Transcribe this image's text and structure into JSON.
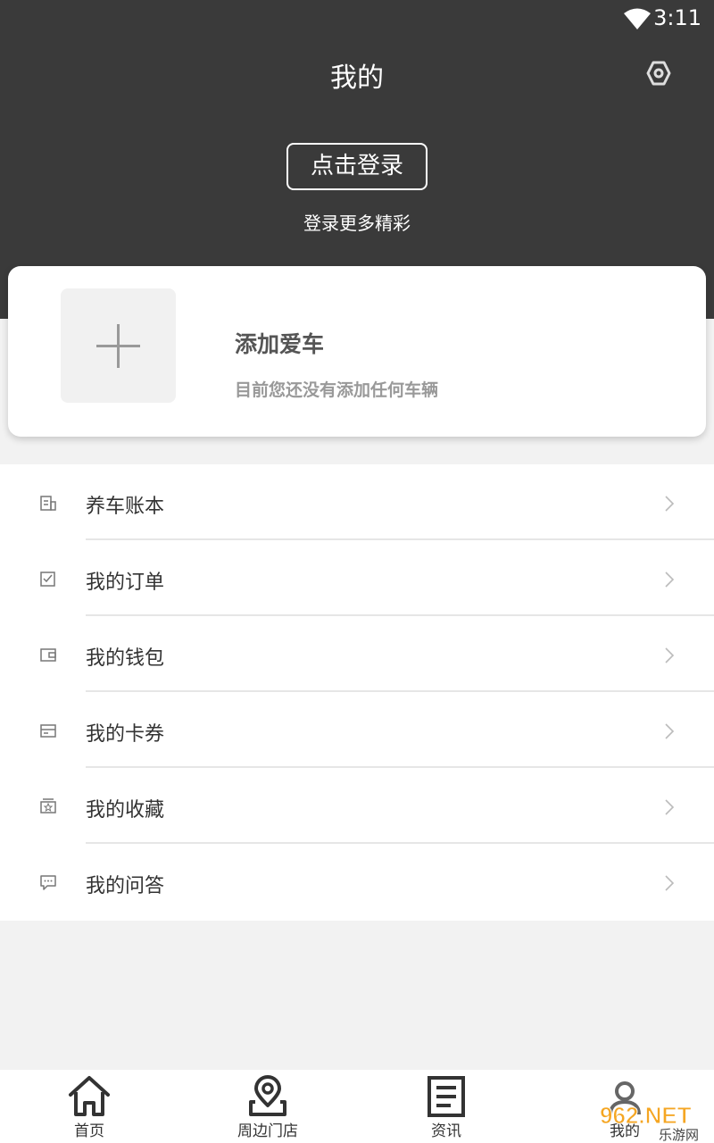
{
  "status_bar": {
    "time": "3:11"
  },
  "header": {
    "title": "我的",
    "login_button": "点击登录",
    "login_subtitle": "登录更多精彩"
  },
  "car_card": {
    "title": "添加爱车",
    "subtitle": "目前您还没有添加任何车辆"
  },
  "menu": {
    "items": [
      {
        "label": "养车账本",
        "icon": "ledger-icon"
      },
      {
        "label": "我的订单",
        "icon": "order-icon"
      },
      {
        "label": "我的钱包",
        "icon": "wallet-icon"
      },
      {
        "label": "我的卡券",
        "icon": "coupon-icon"
      },
      {
        "label": "我的收藏",
        "icon": "favorite-icon"
      },
      {
        "label": "我的问答",
        "icon": "qa-icon"
      }
    ]
  },
  "tabbar": {
    "tabs": [
      {
        "label": "首页",
        "icon": "home-icon"
      },
      {
        "label": "周边门店",
        "icon": "location-icon"
      },
      {
        "label": "资讯",
        "icon": "news-icon"
      },
      {
        "label": "我的",
        "icon": "profile-icon"
      }
    ]
  },
  "watermark": {
    "text": "962.NET",
    "subtext": "乐游网"
  },
  "colors": {
    "header_bg": "#3a3a3a",
    "page_bg": "#f2f2f2",
    "text": "#333333"
  }
}
